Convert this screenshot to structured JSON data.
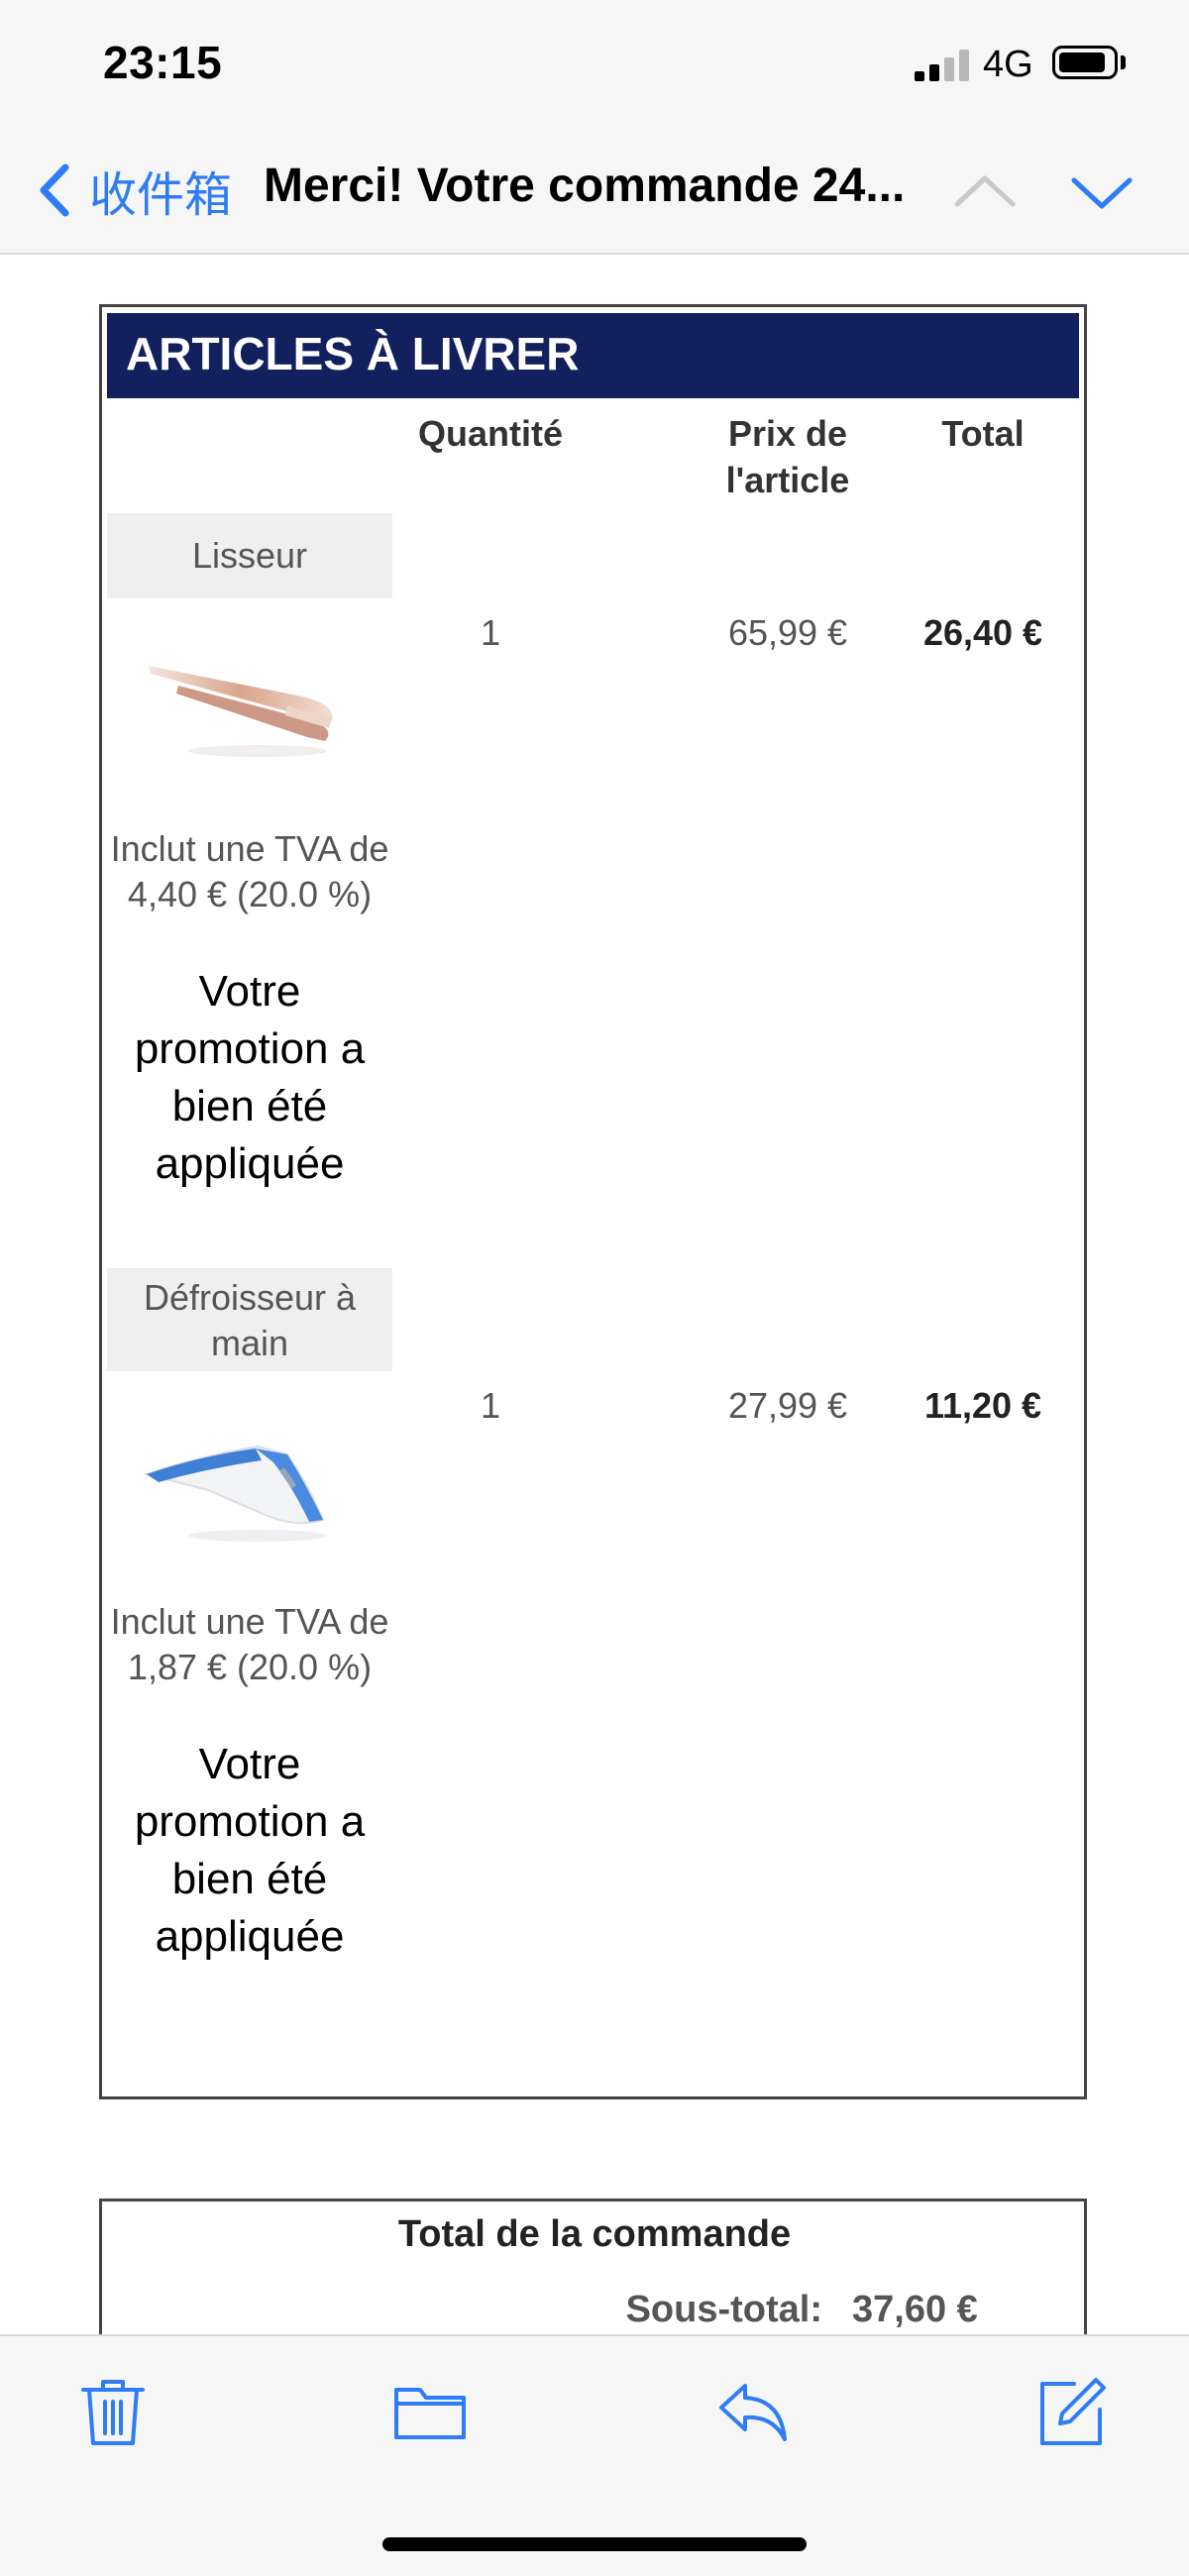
{
  "status_bar": {
    "time": "23:15",
    "network": "4G",
    "signal_bars": 2,
    "battery_level": "full"
  },
  "nav": {
    "back_label": "收件箱",
    "title": "Merci! Votre commande 24...",
    "accent_color": "#2f7cf6"
  },
  "items_section": {
    "header": "ARTICLES À LIVRER",
    "header_color": "#13205e",
    "columns": {
      "quantity": "Quantité",
      "unit_price": "Prix de l'article",
      "total": "Total"
    },
    "items": [
      {
        "name": "Lisseur",
        "image_icon": "hair-straightener-image",
        "quantity": "1",
        "unit_price": "65,99 €",
        "total": "26,40 €",
        "vat": "Inclut une TVA de 4,40 € (20.0 %)",
        "promo": "Votre promotion a bien été appliquée"
      },
      {
        "name": "Défroisseur à main",
        "image_icon": "garment-steamer-image",
        "quantity": "1",
        "unit_price": "27,99 €",
        "total": "11,20 €",
        "vat": "Inclut une TVA de 1,87 € (20.0 %)",
        "promo": "Votre promotion a bien été appliquée"
      }
    ]
  },
  "totals": {
    "title": "Total de la commande",
    "subtotal_label": "Sous-total:",
    "subtotal_value": "37,60 €"
  },
  "toolbar": {
    "icons": [
      "trash-icon",
      "folder-icon",
      "reply-icon",
      "compose-icon"
    ]
  }
}
